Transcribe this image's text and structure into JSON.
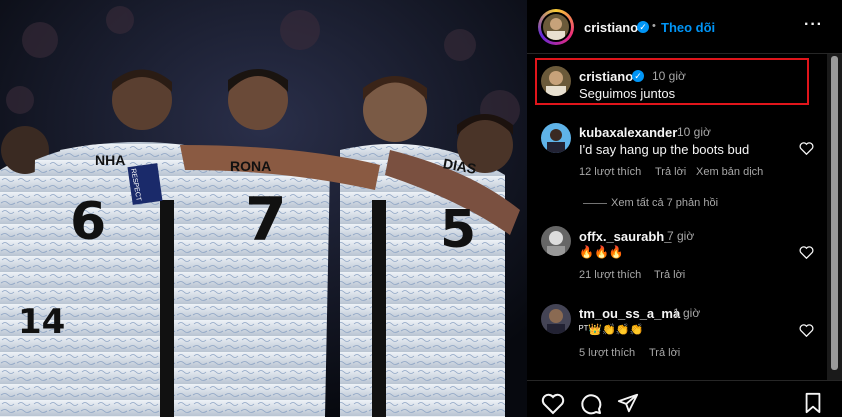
{
  "post": {
    "author": "cristiano",
    "separator": "•",
    "follow_label": "Theo dõi",
    "more_label": "···",
    "verified_mark": "✓"
  },
  "caption": {
    "author": "cristiano",
    "time": "10 giờ",
    "text": "Seguimos juntos"
  },
  "comments": [
    {
      "author": "kubaxalexander",
      "time": "10 giờ",
      "text": "I'd say hang up the boots bud",
      "likes": "12 lượt thích",
      "reply_label": "Trả lời",
      "translate_label": "Xem bản dịch",
      "view_replies": "Xem tất cả 7 phản hồi"
    },
    {
      "author": "offx._saurabh_",
      "time": "7 giờ",
      "text": "🔥🔥🔥",
      "likes": "21 lượt thích",
      "reply_label": "Trả lời"
    },
    {
      "author": "tm_ou_ss_a_ma",
      "time": "1 giờ",
      "text": "ᴾᵀ👑👏👏👏",
      "likes": "5 lượt thích",
      "reply_label": "Trả lời"
    }
  ],
  "photo": {
    "jersey_numbers": [
      "6",
      "7",
      "5",
      "14"
    ],
    "jersey_names": [
      "NHA",
      "RONA",
      "DIAS"
    ],
    "armband_text": "RESPECT"
  },
  "icons": [
    "heart-icon",
    "comment-icon",
    "share-icon",
    "bookmark-icon"
  ],
  "colors": {
    "accent": "#0095f6",
    "highlight": "#e0151b",
    "background": "#000000",
    "muted": "#a8a8a8"
  }
}
